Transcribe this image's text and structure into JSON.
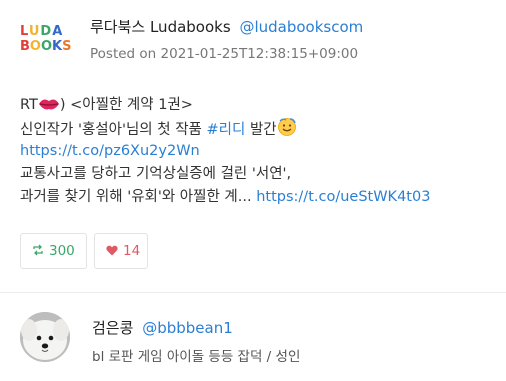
{
  "tweet": {
    "author": {
      "display_name": "루다북스 Ludabooks",
      "handle": "@ludabookscom",
      "logo_text_line1": "LUDA",
      "logo_text_line2": "BOOKS"
    },
    "posted_label": "Posted on 2021-01-25T12:38:15+09:00",
    "body": {
      "line1_prefix": "RT",
      "line1_suffix": ") <아찔한 계약 1권>",
      "line2_prefix": "신인작가 '홍설아'님의 첫 작품 ",
      "line2_hashtag": "#리디",
      "line2_suffix": " 발간",
      "line3_link": "https://t.co/pz6Xu2y2Wn",
      "line4": "교통사고를 당하고 기억상실증에 걸린 '서연',",
      "line5_text": "과거를 찾기 위해 '유회'와 아찔한 계... ",
      "line5_link": "https://t.co/ueStWK4t03"
    },
    "actions": {
      "retweet_count": "300",
      "like_count": "14"
    },
    "icons": {
      "lips": "lips-emoji-icon",
      "face": "smiling-face-emoji-icon",
      "retweet": "retweet-icon",
      "heart": "heart-icon"
    },
    "colors": {
      "link": "#2a7fd4",
      "retweet": "#3aa66a",
      "like": "#e05a65"
    }
  },
  "user2": {
    "display_name": "검은콩",
    "handle": "@bbbbean1",
    "bio": "bl 로판 게임 아이돌 등등 잡덕 / 성인",
    "avatar_icon": "white-dog-avatar"
  }
}
